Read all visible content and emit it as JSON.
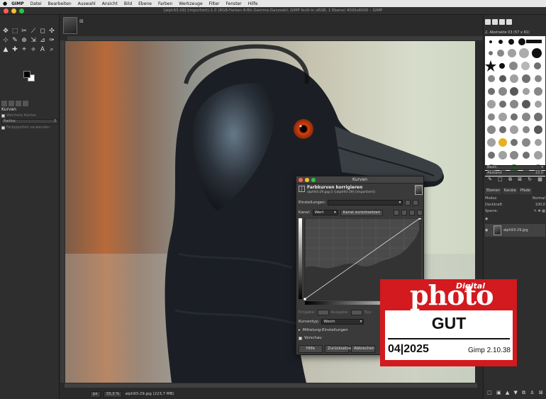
{
  "menubar": {
    "apple": "",
    "items": [
      "GIMP",
      "Datei",
      "Bearbeiten",
      "Auswahl",
      "Ansicht",
      "Bild",
      "Ebene",
      "Farben",
      "Werkzeuge",
      "Filter",
      "Fenster",
      "Hilfe"
    ]
  },
  "window": {
    "title": "[alph93-29] (importiert)-1.0 (RGB-Farben 8-Bit-Gamma-Ganzzahl, GIMP built-in sRGB, 1 Ebene) 4000x6000 – GIMP"
  },
  "toolbox": {
    "tools": [
      "✥",
      "⬚",
      "✂",
      "⟋",
      "◻",
      "✣",
      "⊹",
      "✎",
      "⊕",
      "⇲",
      "⊿",
      "✑",
      "▲",
      "✚",
      "⌖",
      "⟡",
      "Α",
      "⌕",
      "◔",
      "",
      "",
      "",
      "",
      ""
    ],
    "tool_options": {
      "title": "Kurven",
      "antialias": "Weichere Kanten",
      "radius_label": "Radius",
      "radius_value": "3",
      "sample_merged": "Farbpipetten verwenden"
    },
    "bottom_icons": [
      "⬇",
      "↺",
      "⊠",
      "↻"
    ]
  },
  "statusbar": {
    "unit": "px",
    "zoom": "33,3 %",
    "info": "alph93-29.jpg (223,7 MB)"
  },
  "dock": {
    "brush_name": "2. Abstrakte 03 (57 x 61)",
    "preset": "Basic,",
    "spacing_label": "Abstand",
    "spacing_value": "10,0",
    "layer_tabs": [
      "Ebenen",
      "Kanäle",
      "Pfade"
    ],
    "mode_label": "Modus",
    "mode_value": "Normal",
    "opacity_label": "Deckkraft",
    "opacity_value": "100,0",
    "lock_label": "Sperre:",
    "layer_name": "alph93-29.jpg"
  },
  "curves_dialog": {
    "title": "Kurven",
    "heading": "Farbkurven korrigieren",
    "subheading": "alph93-29.jpg-2 ([alph93-29] (importiert))",
    "presets_label": "Einstellungen:",
    "channel_label": "Kanal:",
    "channel_value": "Wert",
    "reset_channel": "Kanal zurücksetzen",
    "input_label": "Eingabe:",
    "output_label": "Ausgabe:",
    "type_label": "Typ:",
    "curve_type_label": "Kurventyp:",
    "curve_type_value": "Weich",
    "blend_options": "Mittelung-Einstellungen",
    "preview": "Vorschau",
    "buttons": [
      "Hilfe",
      "Zurücksetzen",
      "Abbrechen"
    ]
  },
  "badge": {
    "brand_top": "Digital",
    "brand": "photo",
    "rating": "GUT",
    "issue": "04|2025",
    "version": "Gimp 2.10.38"
  },
  "colors": {
    "accent_red": "#d21a1f",
    "light_red": "#ff5f57",
    "light_yellow": "#febc2e",
    "light_green": "#28c840"
  }
}
